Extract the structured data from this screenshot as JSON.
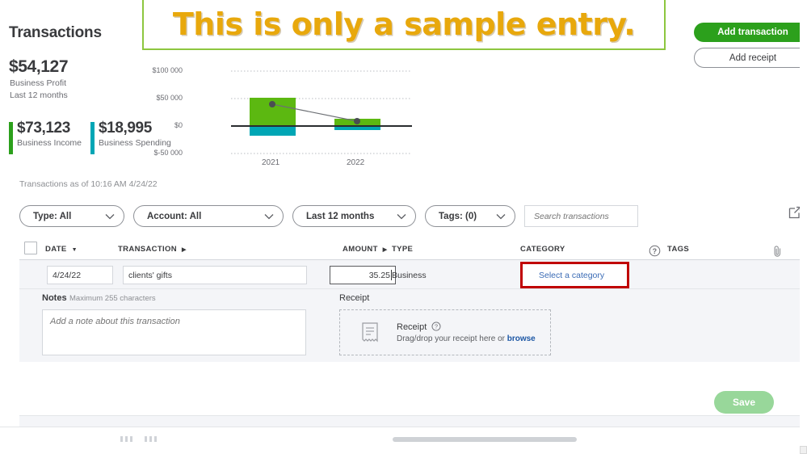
{
  "header": {
    "title": "Transactions",
    "profit_amount": "$54,127",
    "profit_label": "Business Profit",
    "profit_period": "Last 12 months",
    "kpis": [
      {
        "value": "$73,123",
        "label": "Business Income",
        "color": "#2ca01c"
      },
      {
        "value": "$18,995",
        "label": "Business Spending",
        "color": "#00a6b5"
      }
    ],
    "sample_banner": "This is only a sample entry.",
    "sample_banner_color": "#e8a80c",
    "sample_banner_border": "#8dc63f"
  },
  "actions": {
    "add_transaction": "Add transaction",
    "add_receipt": "Add receipt"
  },
  "chart_data": {
    "type": "bar",
    "title": "",
    "categories": [
      "2021",
      "2022"
    ],
    "series": [
      {
        "name": "Business Income",
        "values": [
          52000,
          13000
        ],
        "color": "#5cb811"
      },
      {
        "name": "Business Spending",
        "values": [
          -17000,
          -5000
        ],
        "color": "#00a6b5"
      },
      {
        "name": "Business Profit",
        "values": [
          41000,
          9000
        ],
        "color": "#4a4d52",
        "type": "line"
      }
    ],
    "ytick_labels": [
      "$100 000",
      "$50 000",
      "$0",
      "$-50 000"
    ],
    "ytick_values": [
      100000,
      50000,
      0,
      -50000
    ],
    "ylim": [
      -50000,
      100000
    ],
    "xlabel": "",
    "ylabel": "",
    "grid": true,
    "legend": "none"
  },
  "panel": {
    "as_of": "Transactions as of 10:16 AM 4/24/22",
    "filters": [
      {
        "name": "type",
        "label": "Type: All"
      },
      {
        "name": "account",
        "label": "Account: All"
      },
      {
        "name": "date",
        "label": "Last 12 months"
      },
      {
        "name": "tags",
        "label": "Tags: (0)"
      }
    ],
    "search_placeholder": "Search transactions",
    "search_value": "",
    "columns": {
      "date": "DATE",
      "transaction": "TRANSACTION",
      "amount": "AMOUNT",
      "type": "TYPE",
      "category": "CATEGORY",
      "tags": "TAGS"
    },
    "row": {
      "date": "4/24/22",
      "transaction": "clients' gifts",
      "amount": "35.25",
      "type": "Business",
      "category_placeholder": "Select a category",
      "category_highlight_color": "#c00000"
    },
    "detail": {
      "notes_label": "Notes",
      "notes_hint": "Maximum 255 characters",
      "notes_placeholder": "Add a note about this transaction",
      "notes_value": "",
      "receipt_label": "Receipt",
      "receipt_title": "Receipt",
      "receipt_drop_text": "Drag/drop your receipt here or ",
      "receipt_browse": "browse"
    },
    "save_label": "Save"
  }
}
